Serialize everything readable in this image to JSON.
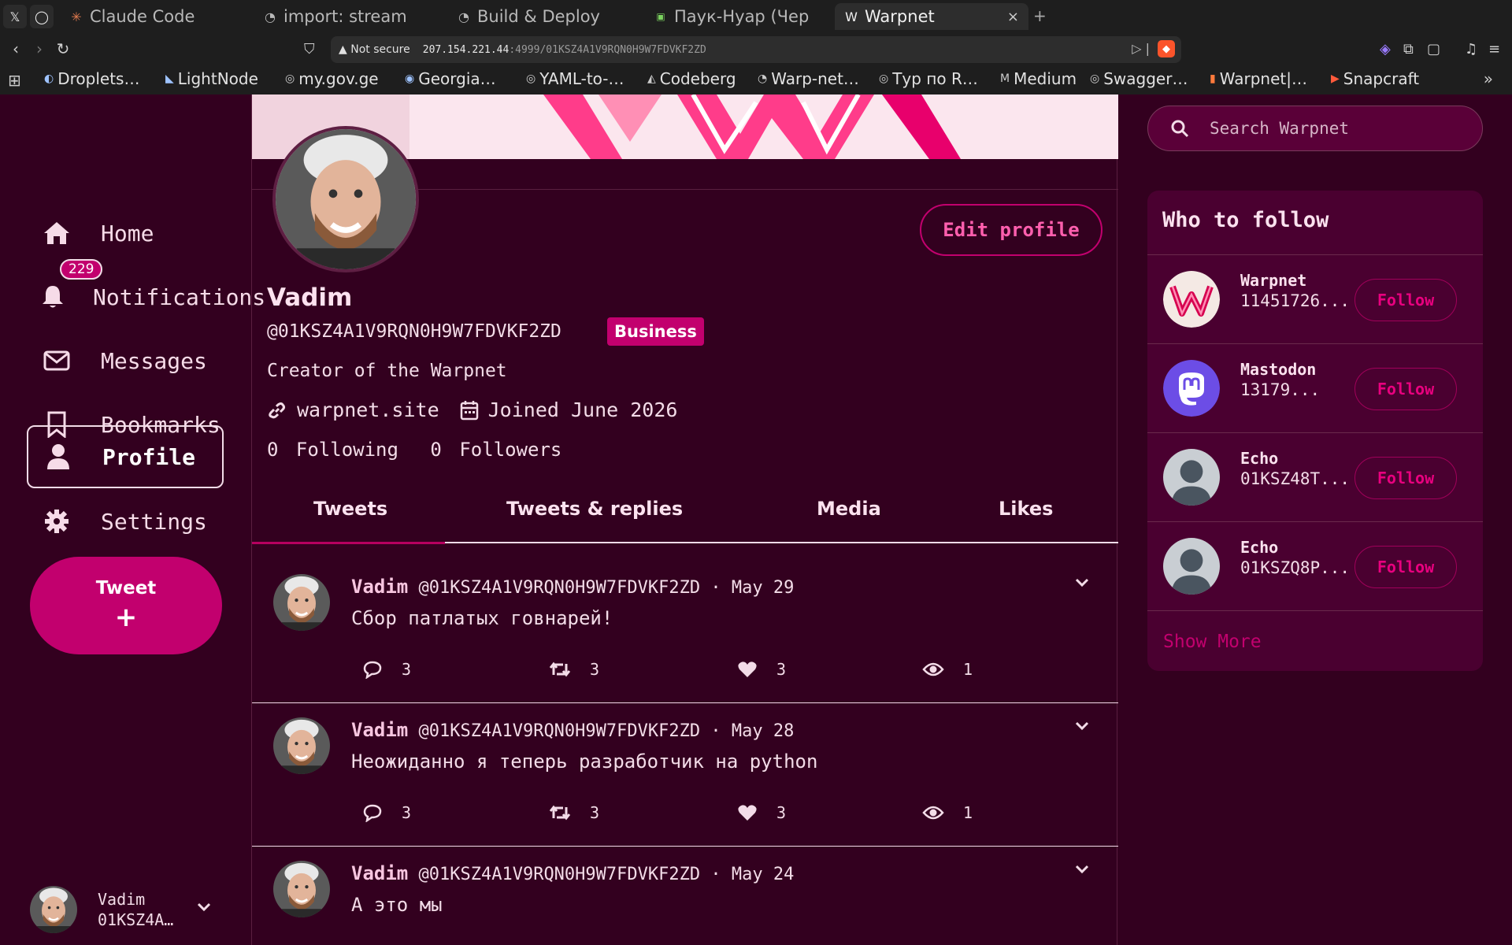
{
  "browser": {
    "pinned_tabs": [
      {
        "icon": "x-icon",
        "glyph": "𝕏"
      },
      {
        "icon": "github-icon",
        "glyph": "◯"
      }
    ],
    "tabs": [
      {
        "title": "Claude Code",
        "icon": "claude-icon"
      },
      {
        "title": "import: stream",
        "icon": "github-icon"
      },
      {
        "title": "Build & Deploy",
        "icon": "github-icon"
      },
      {
        "title": "Паук-Нуар (Чер",
        "icon": "video-icon"
      },
      {
        "title": "Warpnet",
        "icon": "warpnet-icon"
      }
    ],
    "security_label": "Not secure",
    "url_host": "207.154.221.44",
    "url_path": ":4999/01KSZ4A1V9RQN0H9W7FDVKF2ZD",
    "bookmarks": [
      "Droplets…",
      "LightNode",
      "my.gov.ge",
      "Georgia…",
      "YAML-to-…",
      "Codeberg",
      "Warp-net…",
      "Тур по R…",
      "Medium",
      "Swagger…",
      "Warpnet|…",
      "Snapcraft"
    ],
    "more": "»"
  },
  "nav": {
    "items": [
      {
        "label": "Home",
        "icon": "home-icon"
      },
      {
        "label": "Notifications",
        "icon": "bell-icon",
        "badge": "229"
      },
      {
        "label": "Messages",
        "icon": "envelope-icon"
      },
      {
        "label": "Bookmarks",
        "icon": "bookmark-icon"
      },
      {
        "label": "Profile",
        "icon": "user-icon",
        "active": true
      },
      {
        "label": "Settings",
        "icon": "gear-icon"
      }
    ],
    "tweet_button": "Tweet",
    "tweet_plus": "+",
    "account": {
      "name": "Vadim",
      "handle": "01KSZ4A…"
    }
  },
  "profile": {
    "name": "Vadim",
    "handle": "@01KSZ4A1V9RQN0H9W7FDVKF2ZD",
    "badge": "Business",
    "bio": "Creator of the Warpnet",
    "website": "warpnet.site",
    "joined": "Joined June 2026",
    "following_count": "0",
    "following_label": "Following",
    "followers_count": "0",
    "followers_label": "Followers",
    "edit_button": "Edit profile",
    "tabs": [
      "Tweets",
      "Tweets & replies",
      "Media",
      "Likes"
    ],
    "active_tab": 0
  },
  "tweets": [
    {
      "name": "Vadim",
      "handle": "@01KSZ4A1V9RQN0H9W7FDVKF2ZD",
      "date": "· May 29",
      "text": "Сбор патлатых говнарей!",
      "replies": "3",
      "retweets": "3",
      "likes": "3",
      "views": "1"
    },
    {
      "name": "Vadim",
      "handle": "@01KSZ4A1V9RQN0H9W7FDVKF2ZD",
      "date": "· May 28",
      "text": "Неожиданно я теперь разработчик на python",
      "replies": "3",
      "retweets": "3",
      "likes": "3",
      "views": "1"
    },
    {
      "name": "Vadim",
      "handle": "@01KSZ4A1V9RQN0H9W7FDVKF2ZD",
      "date": "· May 24",
      "text": "А это мы"
    }
  ],
  "search": {
    "placeholder": "Search Warpnet"
  },
  "who_to_follow": {
    "title": "Who to follow",
    "items": [
      {
        "name": "Warpnet",
        "sub": "11451726...",
        "follow": "Follow",
        "avatar": "warpnet-logo"
      },
      {
        "name": "Mastodon",
        "sub": "13179...",
        "follow": "Follow",
        "avatar": "mastodon-logo"
      },
      {
        "name": "Echo",
        "sub": "01KSZ48T...",
        "follow": "Follow",
        "avatar": "default-avatar"
      },
      {
        "name": "Echo",
        "sub": "01KSZQ8P...",
        "follow": "Follow",
        "avatar": "default-avatar"
      }
    ],
    "show_more": "Show More"
  },
  "colors": {
    "background": "#33001f",
    "accent": "#c2006e",
    "text": "#f3dce8",
    "panel": "#4a0030"
  }
}
